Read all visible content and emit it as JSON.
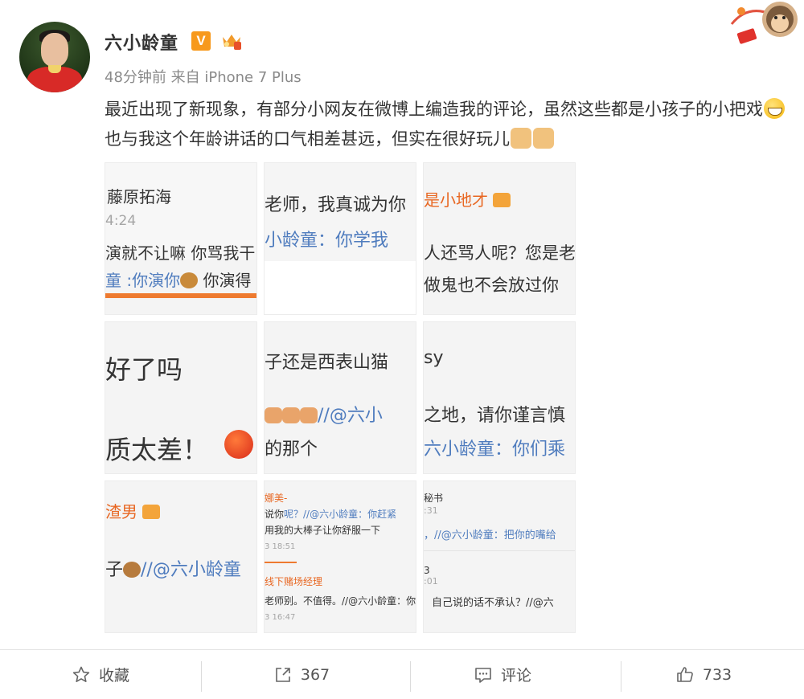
{
  "post": {
    "username": "六小龄童",
    "verified_badge": "V",
    "meta": "48分钟前 来自 iPhone 7 Plus",
    "text_part1": "最近出现了新现象，有部分小网友在微博上编造我的评论，虽然这些都是小孩子的小把戏",
    "text_part2": "也与我这个年龄讲话的口气相差甚远，但实在很好玩儿",
    "emoji_icons": [
      "grin-icon",
      "thumbs-up-icon",
      "handshake-icon"
    ]
  },
  "images": {
    "c1": {
      "l1": "藤原拓海",
      "l2": "4:24",
      "l3": "演就不让嘛 你骂我干",
      "l4a": "童 :你演你",
      "l4b": "你演得"
    },
    "c2": {
      "l1": "老师，我真诚为你",
      "l2": "小龄童：你学我"
    },
    "c3": {
      "l1": "是小地才",
      "l2": "人还骂人呢？您是老",
      "l3": "做鬼也不会放过你"
    },
    "c4": {
      "l1": "好了吗",
      "l2": "质太差！"
    },
    "c5": {
      "l1": "子还是西表山猫",
      "l2": "//@六小",
      "l3": "的那个"
    },
    "c6": {
      "l1": "sy",
      "l2": "之地，请你谨言慎",
      "l3": "六小龄童：你们乘"
    },
    "c7": {
      "l1": "渣男",
      "l2": "子",
      "l3": "//@六小龄童"
    },
    "c8": {
      "l1": "娜美-",
      "l2": "说你",
      "l2b": "呢？//@六小龄童：你赶紧",
      "l3": "用我的大棒子让你舒服一下",
      "l4": "3 18:51",
      "l5": "线下赌场经理",
      "l6": "老师别。不值得。//@六小龄童：你",
      "l7": "3 16:47"
    },
    "c9": {
      "l1": "秘书",
      "l2": ":31",
      "l3": "，//@六小龄童：把你的嘴给",
      "l4": "3",
      "l5": ":01",
      "l6": "自己说的话不承认？//@六"
    }
  },
  "toolbar": {
    "favorite_label": "收藏",
    "repost_count": "367",
    "comment_label": "评论",
    "like_count": "733"
  },
  "colors": {
    "link_blue": "#4f7cbe",
    "orange_name": "#e86722",
    "badge_orange": "#f7991c"
  }
}
